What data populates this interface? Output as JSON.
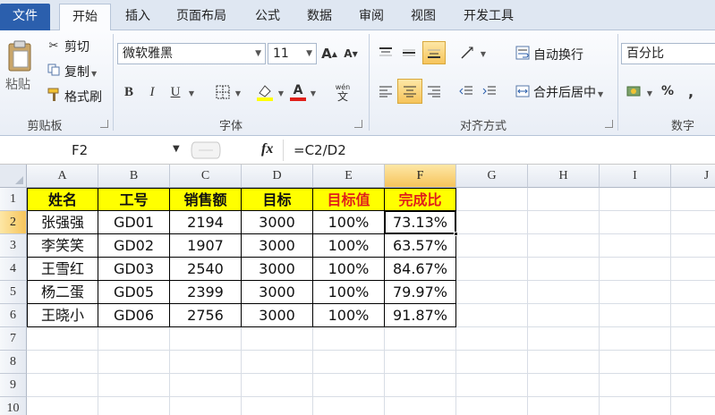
{
  "tabs": [
    {
      "label": "文件"
    },
    {
      "label": "开始"
    },
    {
      "label": "插入"
    },
    {
      "label": "页面布局"
    },
    {
      "label": "公式"
    },
    {
      "label": "数据"
    },
    {
      "label": "审阅"
    },
    {
      "label": "视图"
    },
    {
      "label": "开发工具"
    }
  ],
  "ribbon": {
    "clipboard": {
      "paste": "粘贴",
      "cut": "剪切",
      "copy": "复制",
      "format_painter": "格式刷",
      "label": "剪贴板"
    },
    "font": {
      "name": "微软雅黑",
      "size": "11",
      "label": "字体",
      "bold": "B",
      "italic": "I",
      "underline": "U",
      "grow": "A",
      "shrink": "A",
      "phonetic": "wén",
      "font_color_glyph": "A",
      "highlight_glyph": "A"
    },
    "alignment": {
      "wrap": "自动换行",
      "merge": "合并后居中",
      "label": "对齐方式"
    },
    "number": {
      "format": "百分比",
      "percent": "%",
      "comma": ",",
      "label": "数字"
    },
    "colors": {
      "accent": "#2b5fad",
      "highlight_yellow": "#ffff00",
      "font_red": "#e0201a",
      "active_orange": "#f6c45b"
    }
  },
  "formula_bar": {
    "name_box": "F2",
    "fx": "fx",
    "formula": "=C2/D2"
  },
  "sheet": {
    "columns": [
      "A",
      "B",
      "C",
      "D",
      "E",
      "F",
      "G",
      "H",
      "I",
      "J"
    ],
    "rows": [
      "1",
      "2",
      "3",
      "4",
      "5",
      "6",
      "7",
      "8",
      "9",
      "10"
    ],
    "header": [
      "姓名",
      "工号",
      "销售额",
      "目标",
      "目标值",
      "完成比"
    ],
    "data": [
      [
        "张强强",
        "GD01",
        "2194",
        "3000",
        "100%",
        "73.13%"
      ],
      [
        "李笑笑",
        "GD02",
        "1907",
        "3000",
        "100%",
        "63.57%"
      ],
      [
        "王雪红",
        "GD03",
        "2540",
        "3000",
        "100%",
        "84.67%"
      ],
      [
        "杨二蛋",
        "GD05",
        "2399",
        "3000",
        "100%",
        "79.97%"
      ],
      [
        "王晓小",
        "GD06",
        "2756",
        "3000",
        "100%",
        "91.87%"
      ]
    ],
    "selected_cell": "F2"
  }
}
